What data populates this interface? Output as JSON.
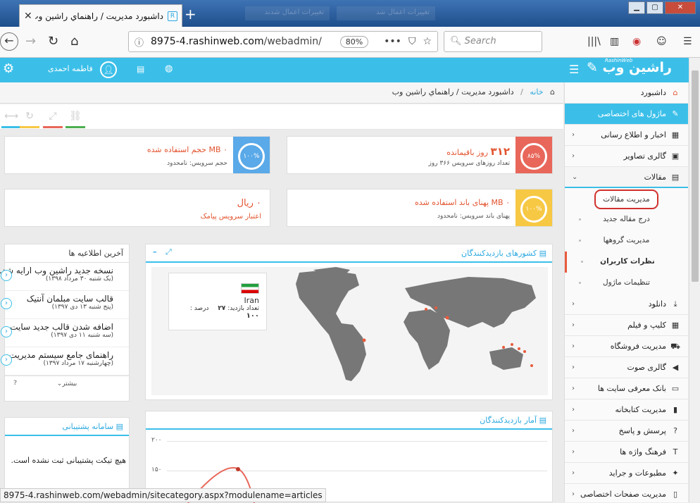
{
  "browser": {
    "tab_title": "داشبورد مدیریت / راهنماي راشين وب",
    "ghost_tabs": [
      "تغییرات اعمال شدند",
      "تغییرات اعمال شد"
    ],
    "url_prefix": "8975-4.rashinweb.com",
    "url_path": "/webadmin/",
    "zoom": "80%",
    "search_placeholder": "Search",
    "status_url": "8975-4.rashinweb.com/webadmin/sitecategory.aspx?modulename=articles"
  },
  "header": {
    "logo": "راشین وب",
    "logo_small": "RashinWeb",
    "user": "فاطمه احمدی"
  },
  "breadcrumb": {
    "home": "خانه",
    "current": "داشبورد مدیریت / راهنماي راشين وب"
  },
  "cards": {
    "days": {
      "value": "۳۱۲",
      "label": "روز باقیمانده",
      "sub": "تعداد روزهای سرویس ۳۶۶ روز",
      "percent": "۸۵%",
      "color": "#e8675a"
    },
    "disk": {
      "value": "۰",
      "label": "MB حجم استفاده شده",
      "sub": "حجم سرویس: نامحدود",
      "percent": "۱۰۰%",
      "color": "#5aa9e8"
    },
    "bw": {
      "value": "۰",
      "label": "MB پهنای باند استفاده شده",
      "sub": "پهنای باند سرویس: نامحدود",
      "percent": "۱۰۰%",
      "color": "#f7c843"
    },
    "sms": {
      "value": "۰ ریال",
      "sub": "اعتبار سرویس پیامک"
    }
  },
  "news": {
    "title": "آخرین اطلاعیه ها",
    "items": [
      {
        "t": "نسخه جدید راشین وب ارایه شد.",
        "d": "(یک شنبه ۳۰ مرداد ۱۳۹۸)"
      },
      {
        "t": "قالب سایت مبلمان آنتیک",
        "d": "(پنج شنبه ۱۳ دی ۱۳۹۷)"
      },
      {
        "t": "اضافه شدن قالب جدید سایت",
        "d": "(سه شنبه ۱۱ دی ۱۳۹۷)"
      },
      {
        "t": "راهنمای جامع سیستم مدیریت",
        "d": "(چهارشنبه ۱۷ مرداد ۱۳۹۷)"
      }
    ],
    "more": "بیشتر",
    "help": "?"
  },
  "support": {
    "title": "سامانه پشتیبانی",
    "empty": "هیچ تیکت پشتیبانی ثبت نشده است."
  },
  "map": {
    "title": "کشورهای بازدیدکنندگان",
    "country": "Iran",
    "visits_label": "تعداد بازدید:",
    "visits": "۲۷",
    "percent_label": "درصد :",
    "percent": "۱۰۰"
  },
  "stats": {
    "title": "آمار بازدیدکنندگان",
    "y_ticks": [
      "۲۰۰",
      "۱۵۰",
      "۱۰۰"
    ]
  },
  "sidebar": {
    "dashboard": "داشبورد",
    "modules": "ماژول های اختصاصی",
    "items_top": [
      "اخبار و اطلاع رسانی",
      "گالری تصاویر"
    ],
    "articles": "مقالات",
    "articles_sub": [
      "مدیریت مقالات",
      "درج مقاله جدید",
      "مدیریت گروهها",
      "نظرات کاربران",
      "تنظیمات ماژول"
    ],
    "items_bottom": [
      "دانلود",
      "کلیپ و فیلم",
      "مدیریت فروشگاه",
      "گالری صوت",
      "بانک معرفی سایت ها",
      "مدیریت کتابخانه",
      "پرسش و پاسخ",
      "فرهنگ واژه ها",
      "مطبوعات و جراید",
      "مدیریت صفحات اختصاصی"
    ]
  }
}
